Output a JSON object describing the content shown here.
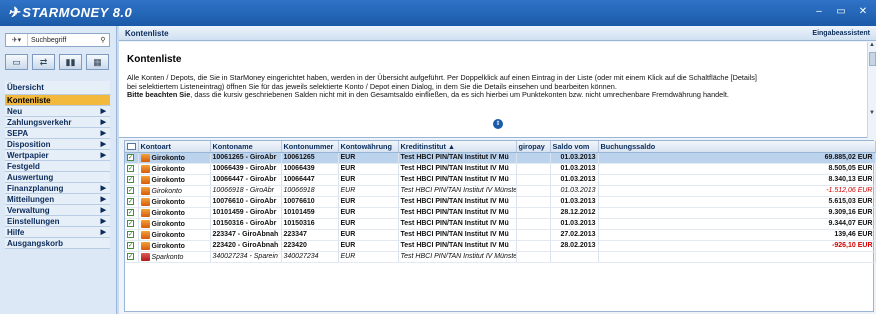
{
  "app": {
    "logo_text": "STARMONEY 8.0",
    "minimize": "–",
    "maximize": "▭",
    "close": "✕"
  },
  "sidebar": {
    "search_placeholder": "Suchbegriff",
    "search_icon": "magnifier-icon",
    "icons": [
      "card-icon",
      "transfer-icon",
      "chart-icon",
      "calculator-icon"
    ],
    "nav": [
      {
        "label": "Übersicht",
        "active": false,
        "arrow": false
      },
      {
        "label": "Kontenliste",
        "active": true,
        "arrow": false
      },
      {
        "label": "Neu",
        "active": false,
        "arrow": true
      },
      {
        "label": "Zahlungsverkehr",
        "active": false,
        "arrow": true
      },
      {
        "label": "SEPA",
        "active": false,
        "arrow": true
      },
      {
        "label": "Disposition",
        "active": false,
        "arrow": true
      },
      {
        "label": "Wertpapier",
        "active": false,
        "arrow": true
      },
      {
        "label": "Festgeld",
        "active": false,
        "arrow": false
      },
      {
        "label": "Auswertung",
        "active": false,
        "arrow": false
      },
      {
        "label": "Finanzplanung",
        "active": false,
        "arrow": true
      },
      {
        "label": "Mitteilungen",
        "active": false,
        "arrow": true
      },
      {
        "label": "Verwaltung",
        "active": false,
        "arrow": true
      },
      {
        "label": "Einstellungen",
        "active": false,
        "arrow": true
      },
      {
        "label": "Hilfe",
        "active": false,
        "arrow": true
      },
      {
        "label": "Ausgangskorb",
        "active": false,
        "arrow": false
      }
    ]
  },
  "header": {
    "title": "Kontenliste",
    "assistant": "Eingabeassistent"
  },
  "info": {
    "title": "Kontenliste",
    "line1": "Alle Konten / Depots, die Sie in StarMoney eingerichtet haben, werden in der Übersicht aufgeführt. Per Doppelklick auf einen Eintrag in der Liste (oder mit einem Klick auf die Schaltfläche [Details]",
    "line2": "bei selektiertem Listeneintrag) öffnen Sie für das jeweils selektierte Konto / Depot einen Dialog, in dem Sie die Details einsehen und bearbeiten können.",
    "line3_bold": "Bitte beachten Sie",
    "line3_rest": ", dass die kursiv geschriebenen Salden nicht mit in den Gesamtsaldo einfließen, da es sich hierbei um Punktekonten bzw. nicht umrechenbare Fremdwährung handelt."
  },
  "table": {
    "columns": [
      "Kontoart",
      "Kontoname",
      "Kontonummer",
      "Kontowährung",
      "Kreditinstitut ▲",
      "giropay",
      "Saldo vom",
      "Buchungssaldo"
    ],
    "rows": [
      {
        "art": "Girokonto",
        "name": "10061265 - GiroAbr",
        "nr": "10061265",
        "cur": "EUR",
        "bank": "Test HBCI PIN/TAN Institut IV Mü",
        "date": "01.03.2013",
        "saldo": "69.885,02 EUR",
        "neg": false,
        "italic": false,
        "sel": true,
        "icon": "giro"
      },
      {
        "art": "Girokonto",
        "name": "10066439 - GiroAbr",
        "nr": "10066439",
        "cur": "EUR",
        "bank": "Test HBCI PIN/TAN Institut IV Mü",
        "date": "01.03.2013",
        "saldo": "8.505,05 EUR",
        "neg": false,
        "italic": false,
        "sel": false,
        "icon": "giro"
      },
      {
        "art": "Girokonto",
        "name": "10066447 - GiroAbr",
        "nr": "10066447",
        "cur": "EUR",
        "bank": "Test HBCI PIN/TAN Institut IV Mü",
        "date": "01.03.2013",
        "saldo": "8.340,13 EUR",
        "neg": false,
        "italic": false,
        "sel": false,
        "icon": "giro"
      },
      {
        "art": "Girokonto",
        "name": "10066918 - GiroAbr",
        "nr": "10066918",
        "cur": "EUR",
        "bank": "Test HBCI PIN/TAN Institut IV Münste",
        "date": "01.03.2013",
        "saldo": "-1.512,06 EUR",
        "neg": true,
        "italic": true,
        "sel": false,
        "icon": "giro"
      },
      {
        "art": "Girokonto",
        "name": "10076610 - GiroAbr",
        "nr": "10076610",
        "cur": "EUR",
        "bank": "Test HBCI PIN/TAN Institut IV Mü",
        "date": "01.03.2013",
        "saldo": "5.615,03 EUR",
        "neg": false,
        "italic": false,
        "sel": false,
        "icon": "giro"
      },
      {
        "art": "Girokonto",
        "name": "10101459 - GiroAbr",
        "nr": "10101459",
        "cur": "EUR",
        "bank": "Test HBCI PIN/TAN Institut IV Mü",
        "date": "28.12.2012",
        "saldo": "9.309,16 EUR",
        "neg": false,
        "italic": false,
        "sel": false,
        "icon": "giro"
      },
      {
        "art": "Girokonto",
        "name": "10150316 - GiroAbr",
        "nr": "10150316",
        "cur": "EUR",
        "bank": "Test HBCI PIN/TAN Institut IV Mü",
        "date": "01.03.2013",
        "saldo": "9.344,07 EUR",
        "neg": false,
        "italic": false,
        "sel": false,
        "icon": "giro"
      },
      {
        "art": "Girokonto",
        "name": "223347 - GiroAbnah",
        "nr": "223347",
        "cur": "EUR",
        "bank": "Test HBCI PIN/TAN Institut IV Mü",
        "date": "27.02.2013",
        "saldo": "139,46 EUR",
        "neg": false,
        "italic": false,
        "sel": false,
        "icon": "giro"
      },
      {
        "art": "Girokonto",
        "name": "223420 - GiroAbnah",
        "nr": "223420",
        "cur": "EUR",
        "bank": "Test HBCI PIN/TAN Institut IV Mü",
        "date": "28.02.2013",
        "saldo": "-926,10 EUR",
        "neg": true,
        "italic": false,
        "sel": false,
        "icon": "giro"
      },
      {
        "art": "Sparkonto",
        "name": "340027234 - Sparein",
        "nr": "340027234",
        "cur": "EUR",
        "bank": "Test HBCI PIN/TAN Institut IV Münste",
        "date": "",
        "saldo": "",
        "neg": false,
        "italic": true,
        "sel": false,
        "icon": "spar"
      }
    ]
  }
}
